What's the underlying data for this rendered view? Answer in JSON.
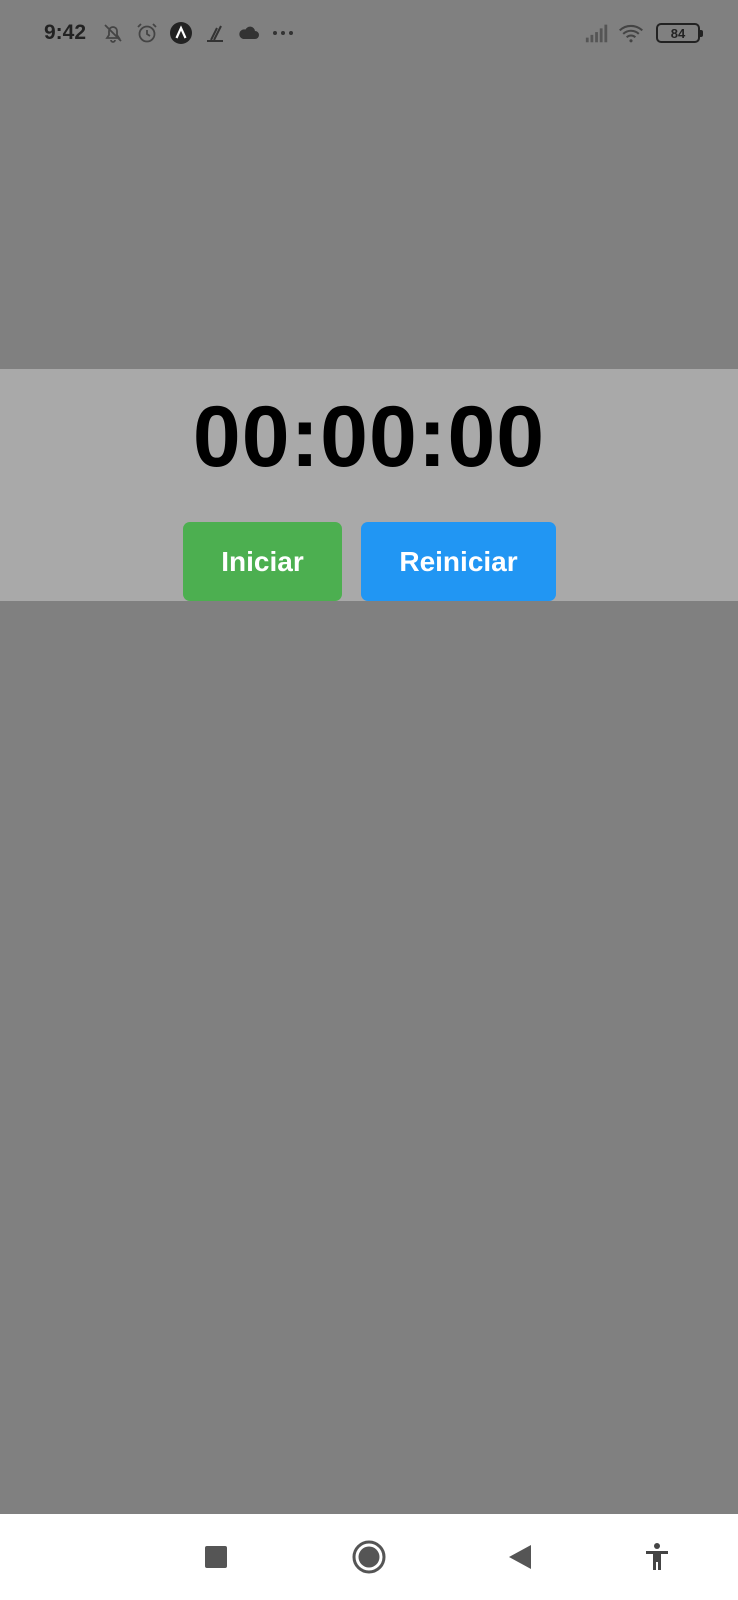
{
  "status_bar": {
    "time": "9:42",
    "battery_level": "84",
    "left_icons": [
      "bell-off-icon",
      "alarm-icon",
      "app-a-icon",
      "running-icon",
      "cloud-icon",
      "more-dots-icon"
    ],
    "right_icons": [
      "signal-icon",
      "wifi-icon",
      "battery-icon"
    ]
  },
  "timer": {
    "display": "00:00:00"
  },
  "buttons": {
    "start_label": "Iniciar",
    "reset_label": "Reiniciar"
  },
  "colors": {
    "background": "#808080",
    "panel": "#a9a9a9",
    "start_button": "#4caf50",
    "reset_button": "#2196f3",
    "nav_bar": "#ffffff"
  },
  "nav_bar": {
    "icons": [
      "recents-square-icon",
      "home-circle-icon",
      "back-triangle-icon",
      "accessibility-icon"
    ]
  }
}
